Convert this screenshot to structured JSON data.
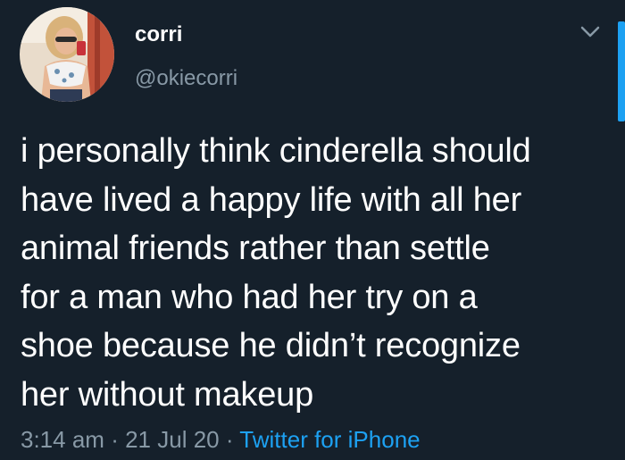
{
  "colors": {
    "background": "#15202b",
    "primary_text": "#ffffff",
    "secondary_text": "#8899a6",
    "accent": "#1da1f2"
  },
  "user": {
    "display_name": "corri",
    "handle": "@okiecorri",
    "avatar_icon": "profile-photo"
  },
  "header": {
    "menu_icon": "chevron-down-icon"
  },
  "tweet": {
    "text": "i personally think cinderella should\nhave lived a happy life with all her\nanimal friends rather than settle\nfor a man who had her try on a\nshoe because he didn’t recognize\nher without makeup",
    "time": "3:14 am",
    "separator": "·",
    "date": "21 Jul 20",
    "source": "Twitter for iPhone"
  }
}
